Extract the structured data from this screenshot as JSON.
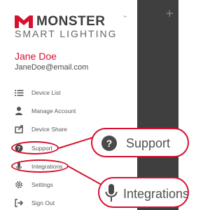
{
  "brand": {
    "name": "MONSTER",
    "trademark": "™",
    "subtitle": "SMART LIGHTING"
  },
  "user": {
    "name": "Jane Doe",
    "email": "JaneDoe@email.com"
  },
  "menu": {
    "items": [
      {
        "label": "Device List",
        "icon": "list-icon"
      },
      {
        "label": "Manage Account",
        "icon": "person-icon"
      },
      {
        "label": "Device Share",
        "icon": "share-icon"
      },
      {
        "label": "Support",
        "icon": "help-circle-icon"
      },
      {
        "label": "Integrations",
        "icon": "microphone-icon"
      },
      {
        "label": "Settings",
        "icon": "gear-icon"
      },
      {
        "label": "Sign Out",
        "icon": "sign-out-icon"
      }
    ]
  },
  "overlay": {
    "plus_label": "+"
  },
  "callouts": {
    "support_label": "Support",
    "integrations_label": "Integrations"
  },
  "colors": {
    "accent": "#d6102e",
    "overlay": "#3f3f3f",
    "text": "#5a5a5a"
  }
}
